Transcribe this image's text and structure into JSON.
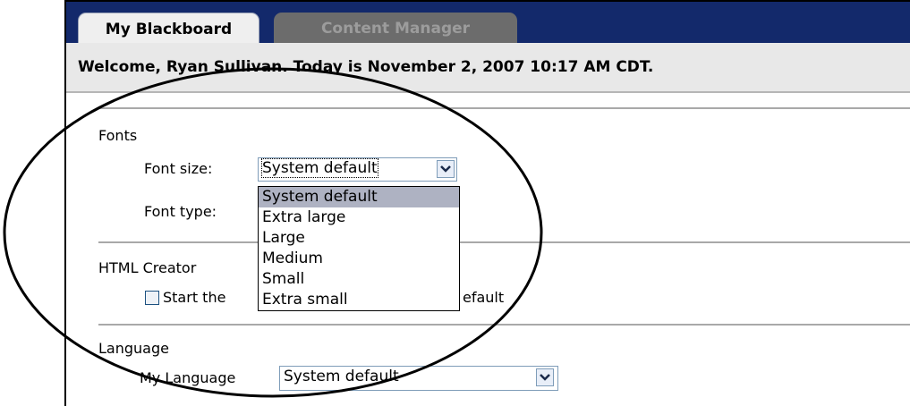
{
  "tabs": [
    {
      "label": "My Blackboard",
      "active": true
    },
    {
      "label": "Content Manager",
      "active": false
    }
  ],
  "welcome": "Welcome, Ryan Sullivan. Today is November 2, 2007 10:17 AM CDT.",
  "fonts": {
    "heading": "Fonts",
    "size_label": "Font size:",
    "size_value": "System default",
    "type_label": "Font type:",
    "size_options": [
      "System default",
      "Extra large",
      "Large",
      "Medium",
      "Small",
      "Extra small"
    ],
    "selected_option": "System default"
  },
  "html_creator": {
    "heading": "HTML Creator",
    "checkbox_left": "Start the",
    "checkbox_right": "efault",
    "checked": false
  },
  "language": {
    "heading": "Language",
    "label": "My Language",
    "value": "System default"
  },
  "colors": {
    "header_bg": "#13296b",
    "tab_active_bg": "#efefef",
    "tab_inactive_bg": "#6c6c6c",
    "welcome_bg": "#e8e8e8",
    "highlight": "#aeb2c2"
  },
  "icons": [
    "chevron-down-icon",
    "checkbox-icon",
    "ellipse-annotation"
  ]
}
